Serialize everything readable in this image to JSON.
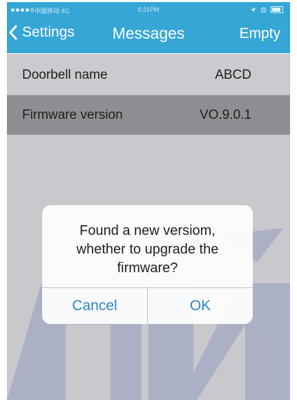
{
  "status_bar": {
    "carrier": "中国移动 4G",
    "time": "6:21PM"
  },
  "nav": {
    "back_label": "Settings",
    "title": "Messages",
    "right_label": "Empty"
  },
  "settings": {
    "rows": [
      {
        "label": "Doorbell name",
        "value": "ABCD"
      },
      {
        "label": "Firmware version",
        "value": "VO.9.0.1"
      }
    ]
  },
  "dialog": {
    "message_lines": [
      "Found a new versiom,",
      "whether to upgrade the",
      "firmware?"
    ],
    "cancel_label": "Cancel",
    "ok_label": "OK"
  },
  "colors": {
    "accent": "#36a6d6",
    "button_text": "#2d86c4",
    "selected_row": "#8e8e93",
    "overlay": "#c8c8cd"
  }
}
